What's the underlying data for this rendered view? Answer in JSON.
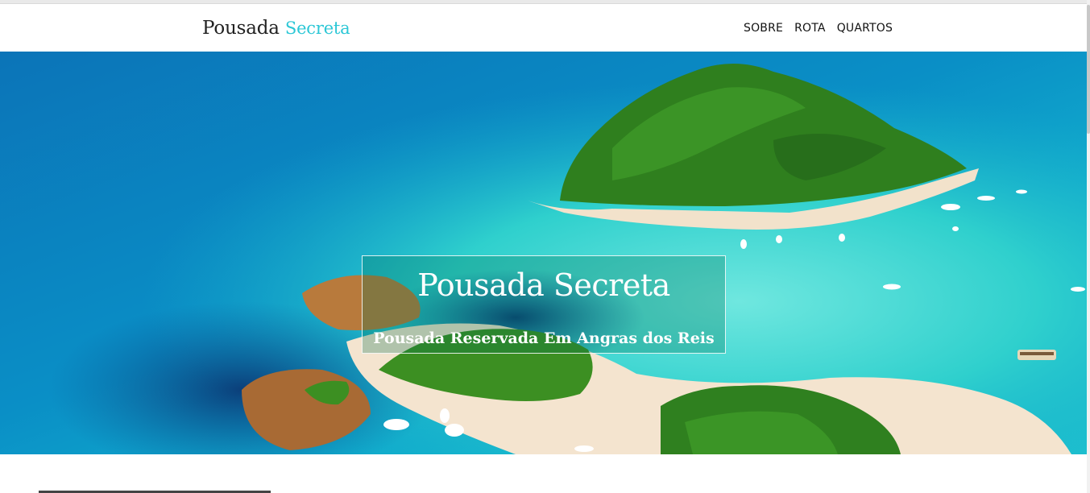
{
  "navbar": {
    "brand_primary": "Pousada",
    "brand_accent": "Secreta",
    "links": [
      "SOBRE",
      "ROTA",
      "QUARTOS"
    ]
  },
  "hero": {
    "title": "Pousada Secreta",
    "subtitle": "Pousada Reservada Em Angras dos Reis",
    "image_alt": "aerial-island-beach-photo"
  },
  "colors": {
    "brand_accent": "#2cc7d6",
    "ocean_deep": "#0a7fc0",
    "lagoon": "#39d6cf",
    "forest": "#2f7f1e",
    "sand": "#f4e4cf"
  }
}
